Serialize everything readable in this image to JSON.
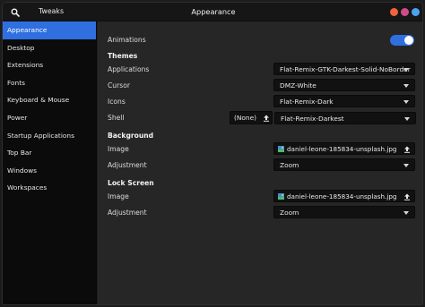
{
  "titlebar": {
    "app_title": "Tweaks",
    "page_title": "Appearance",
    "search_icon": "search-icon",
    "window_buttons": {
      "minimize_color": "#f0643c",
      "maximize_color": "#cf4c88",
      "close_color": "#4aa3ef"
    }
  },
  "sidebar": {
    "items": [
      {
        "label": "Appearance",
        "active": true
      },
      {
        "label": "Desktop"
      },
      {
        "label": "Extensions"
      },
      {
        "label": "Fonts"
      },
      {
        "label": "Keyboard & Mouse"
      },
      {
        "label": "Power"
      },
      {
        "label": "Startup Applications"
      },
      {
        "label": "Top Bar"
      },
      {
        "label": "Windows"
      },
      {
        "label": "Workspaces"
      }
    ]
  },
  "content": {
    "animations": {
      "label": "Animations",
      "enabled": true
    },
    "themes": {
      "title": "Themes",
      "applications": {
        "label": "Applications",
        "value": "Flat-Remix-GTK-Darkest-Solid-NoBorder"
      },
      "cursor": {
        "label": "Cursor",
        "value": "DMZ-White"
      },
      "icons": {
        "label": "Icons",
        "value": "Flat-Remix-Dark"
      },
      "shell": {
        "label": "Shell",
        "none_label": "(None)",
        "value": "Flat-Remix-Darkest"
      }
    },
    "background": {
      "title": "Background",
      "image": {
        "label": "Image",
        "value": "daniel-leone-185834-unsplash.jpg"
      },
      "adjustment": {
        "label": "Adjustment",
        "value": "Zoom"
      }
    },
    "lock_screen": {
      "title": "Lock Screen",
      "image": {
        "label": "Image",
        "value": "daniel-leone-185834-unsplash.jpg"
      },
      "adjustment": {
        "label": "Adjustment",
        "value": "Zoom"
      }
    }
  },
  "colors": {
    "accent": "#2f6fe0",
    "sidebar_bg": "#0b0b0b",
    "content_bg": "#262626"
  }
}
